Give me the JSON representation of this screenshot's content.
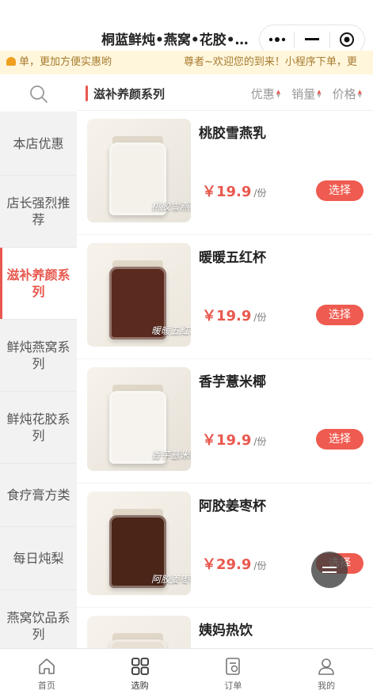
{
  "header": {
    "title": "桐蓝鲜炖•燕窝•花胶•滋补",
    "capsule": {
      "menu_icon": "more-dots-icon",
      "minimize_icon": "minimize-icon",
      "close_icon": "target-close-icon"
    }
  },
  "notice": {
    "left_text": "单，更加方便实惠哟",
    "right_text": "尊者~欢迎您的到来！小程序下单，更"
  },
  "sidebar": {
    "search_icon": "search-icon",
    "categories": [
      {
        "label": "本店优惠"
      },
      {
        "label": "店长强烈推荐"
      },
      {
        "label": "滋补养颜系列",
        "active": true
      },
      {
        "label": "鲜炖燕窝系列"
      },
      {
        "label": "鲜炖花胶系列"
      },
      {
        "label": "食疗膏方类"
      },
      {
        "label": "每日炖梨"
      },
      {
        "label": "燕窝饮品系列"
      }
    ]
  },
  "section": {
    "title": "滋补养颜系列",
    "sorts": [
      {
        "label": "优惠"
      },
      {
        "label": "销量"
      },
      {
        "label": "价格"
      }
    ]
  },
  "products": [
    {
      "name": "桃胶雪燕乳",
      "price": "￥19.9",
      "unit": "/份",
      "button": "选择",
      "image_label": "桃胶雪燕乳",
      "jar_color": "#f4f1ea",
      "bg_color": "#e8e3da"
    },
    {
      "name": "暖暖五红杯",
      "price": "￥19.9",
      "unit": "/份",
      "button": "选择",
      "image_label": "暖暖五红杯",
      "jar_color": "#5a2a1e",
      "bg_color": "#ece6dc"
    },
    {
      "name": "香芋薏米椰",
      "price": "￥19.9",
      "unit": "/份",
      "button": "选择",
      "image_label": "香芋薏米椰",
      "jar_color": "#f6f3ee",
      "bg_color": "#e6e0d6"
    },
    {
      "name": "阿胶姜枣杯",
      "price": "￥29.9",
      "unit": "/份",
      "button": "选择",
      "image_label": "阿胶姜枣杯",
      "jar_color": "#4a2518",
      "bg_color": "#ece7de"
    },
    {
      "name": "姨妈热饮",
      "price": "",
      "unit": "",
      "button": "",
      "image_label": "",
      "jar_color": "#e8e0d4",
      "bg_color": "#ece7de"
    }
  ],
  "tabbar": [
    {
      "label": "首页",
      "icon": "home-icon"
    },
    {
      "label": "选购",
      "icon": "grid-icon",
      "active": true
    },
    {
      "label": "订单",
      "icon": "order-icon"
    },
    {
      "label": "我的",
      "icon": "user-icon"
    }
  ],
  "colors": {
    "accent": "#e8584e",
    "notice_bg": "#fff6dc",
    "notice_text": "#a77b2e"
  }
}
